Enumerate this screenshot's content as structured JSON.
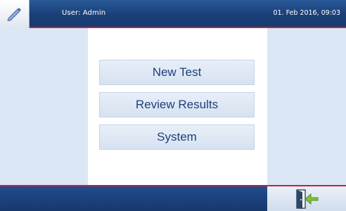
{
  "header": {
    "logo_icon": "pen-logo-icon",
    "user_label": "User: Admin",
    "datetime": "01. Feb 2016, 09:03"
  },
  "menu": {
    "items": [
      {
        "label": "New Test"
      },
      {
        "label": "Review Results"
      },
      {
        "label": "System"
      }
    ]
  },
  "footer": {
    "exit_icon": "exit-door-icon"
  },
  "colors": {
    "header_bg": "#1a3f78",
    "accent_line": "#c0223a",
    "panel_bg": "#dce7f5",
    "button_text": "#1f3f7a",
    "exit_arrow": "#7cc43c"
  }
}
